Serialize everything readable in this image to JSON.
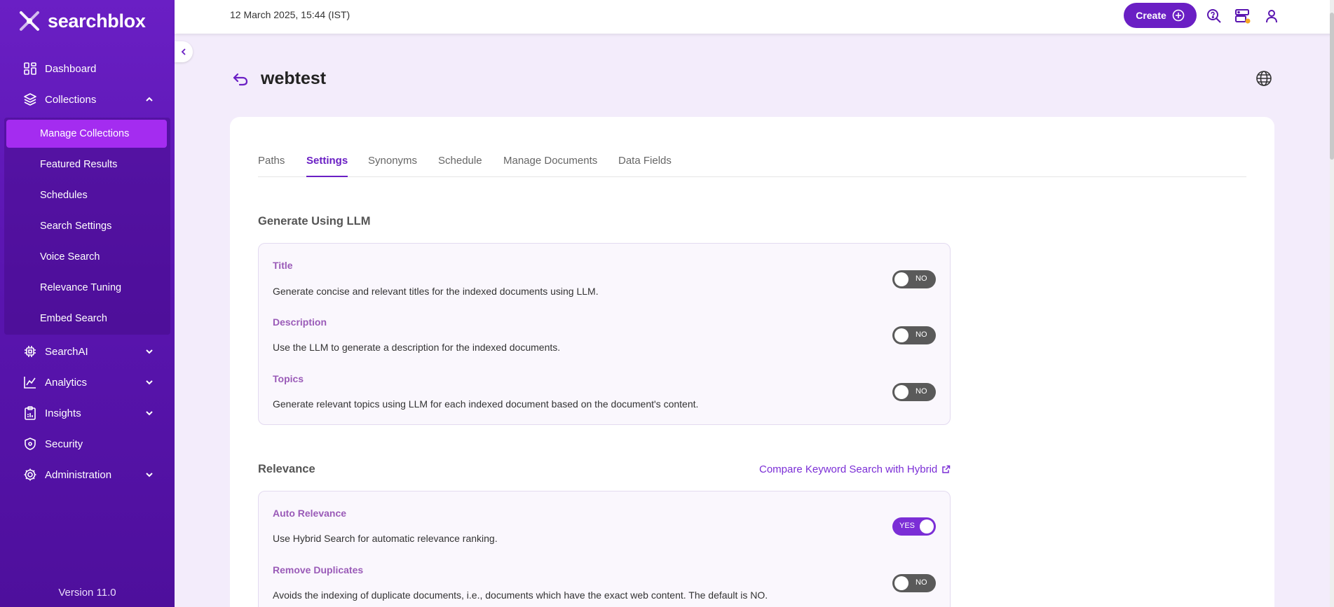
{
  "brand": {
    "name": "searchblox",
    "accent": "#6a1fc4",
    "sidebar_bg": "#5a15b0",
    "active_item_bg": "#a42cf0"
  },
  "sidebar": {
    "items": [
      {
        "label": "Dashboard",
        "icon": "dashboard-icon"
      },
      {
        "label": "Collections",
        "icon": "layers-icon",
        "expanded": true
      },
      {
        "label": "SearchAI",
        "icon": "chip-icon",
        "expanded": false
      },
      {
        "label": "Analytics",
        "icon": "analytics-icon",
        "expanded": false
      },
      {
        "label": "Insights",
        "icon": "clipboard-icon",
        "expanded": false
      },
      {
        "label": "Security",
        "icon": "shield-icon"
      },
      {
        "label": "Administration",
        "icon": "gear-icon",
        "expanded": false
      }
    ],
    "collections_sub": [
      {
        "label": "Manage Collections",
        "active": true
      },
      {
        "label": "Featured Results"
      },
      {
        "label": "Schedules"
      },
      {
        "label": "Search Settings"
      },
      {
        "label": "Voice Search"
      },
      {
        "label": "Relevance Tuning"
      },
      {
        "label": "Embed Search"
      }
    ],
    "version": "Version 11.0"
  },
  "topbar": {
    "date": "12 March 2025, 15:44 (IST)",
    "create_label": "Create"
  },
  "page": {
    "title": "webtest",
    "tabs": [
      "Paths",
      "Settings",
      "Synonyms",
      "Schedule",
      "Manage Documents",
      "Data Fields"
    ],
    "active_tab": "Settings"
  },
  "llm_section": {
    "title": "Generate Using LLM",
    "options": [
      {
        "title": "Title",
        "desc": "Generate concise and relevant titles for the indexed documents using LLM.",
        "state": "NO"
      },
      {
        "title": "Description",
        "desc": "Use the LLM to generate a description for the indexed documents.",
        "state": "NO"
      },
      {
        "title": "Topics",
        "desc": "Generate relevant topics using LLM for each indexed document based on the document's content.",
        "state": "NO"
      }
    ]
  },
  "relevance_section": {
    "title": "Relevance",
    "link": "Compare Keyword Search with Hybrid",
    "options": [
      {
        "title": "Auto Relevance",
        "desc": "Use Hybrid Search for automatic relevance ranking.",
        "state": "YES"
      },
      {
        "title": "Remove Duplicates",
        "desc": "Avoids the indexing of duplicate documents, i.e., documents which have the exact web content. The default is NO.",
        "state": "NO"
      }
    ]
  }
}
